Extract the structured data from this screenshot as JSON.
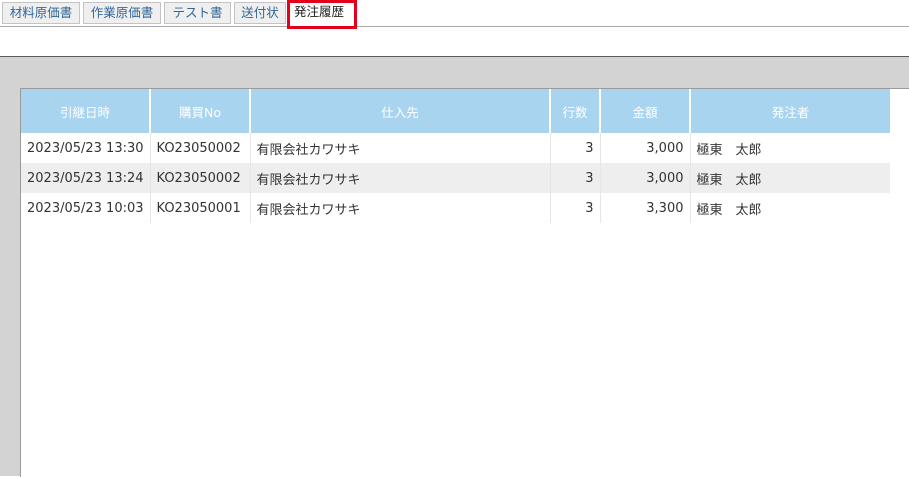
{
  "tabs": [
    {
      "label": "材料原価書",
      "active": false
    },
    {
      "label": "作業原価書",
      "active": false
    },
    {
      "label": "テスト書",
      "active": false
    },
    {
      "label": "送付状",
      "active": false
    },
    {
      "label": "発注履歴",
      "active": true
    }
  ],
  "table": {
    "columns": [
      "引継日時",
      "購買No",
      "仕入先",
      "行数",
      "金額",
      "発注者"
    ],
    "rows": [
      [
        "2023/05/23 13:30",
        "KO23050002",
        "有限会社カワサキ",
        "3",
        "3,000",
        "極東　太郎"
      ],
      [
        "2023/05/23 13:24",
        "KO23050002",
        "有限会社カワサキ",
        "3",
        "3,000",
        "極東　太郎"
      ],
      [
        "2023/05/23 10:03",
        "KO23050001",
        "有限会社カワサキ",
        "3",
        "3,300",
        "極東　太郎"
      ]
    ]
  },
  "colors": {
    "header_bg": "#a9d4ef",
    "active_tab_border": "#e2001a",
    "panel_bg": "#d3d3d3",
    "alt_row_bg": "#eeeeee"
  }
}
